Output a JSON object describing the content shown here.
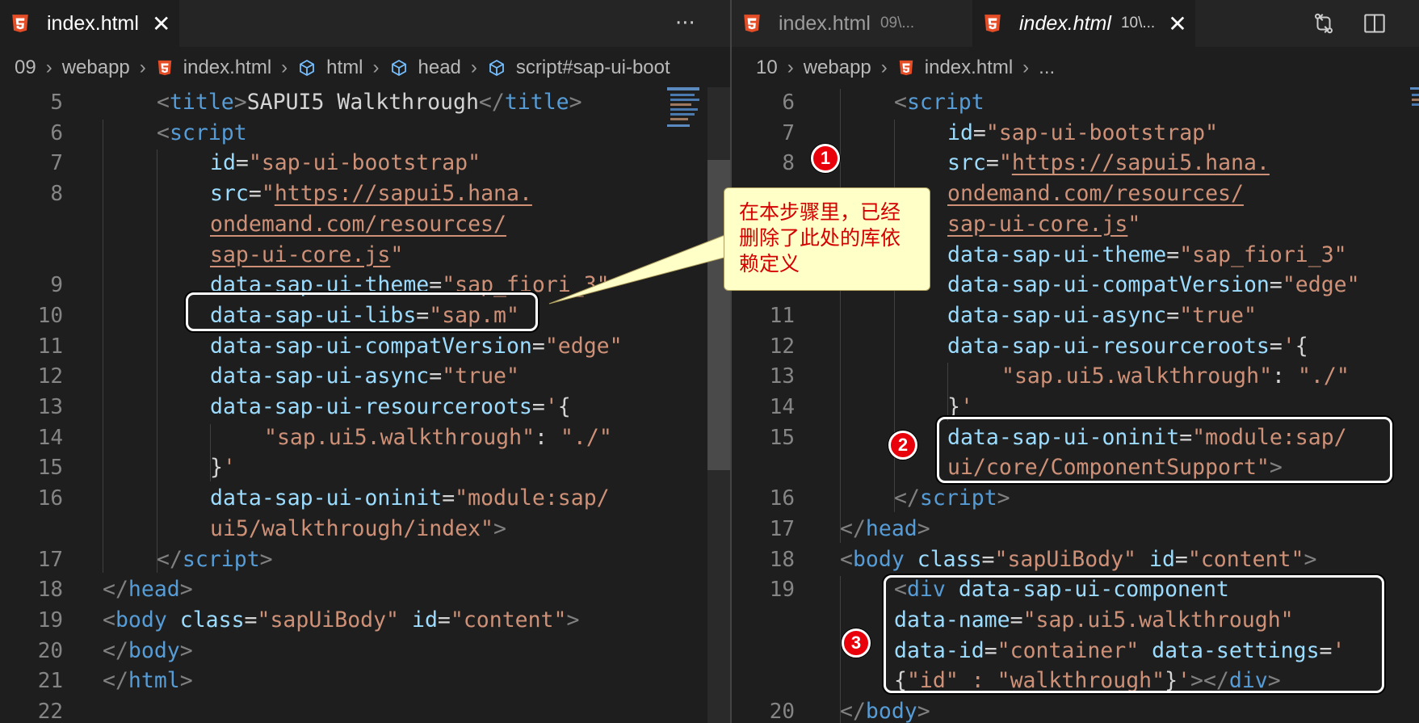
{
  "left": {
    "tabs": [
      {
        "title": "index.html"
      }
    ],
    "more_label": "···",
    "breadcrumb": [
      "09",
      "webapp",
      "index.html",
      "html",
      "head",
      "script#sap-ui-boot"
    ],
    "lines": [
      {
        "num": "5",
        "code": [
          [
            "p",
            "<"
          ],
          [
            "t",
            "title"
          ],
          [
            "p",
            ">"
          ],
          [
            "txt",
            "SAPUI5 Walkthrough"
          ],
          [
            "p",
            "</"
          ],
          [
            "t",
            "title"
          ],
          [
            "p",
            ">"
          ]
        ]
      },
      {
        "num": "6",
        "code": [
          [
            "p",
            "<"
          ],
          [
            "t",
            "script"
          ]
        ]
      },
      {
        "num": "7",
        "code": [
          [
            "a",
            "id"
          ],
          [
            "txt",
            "="
          ],
          [
            "s",
            "\"sap-ui-bootstrap\""
          ]
        ]
      },
      {
        "num": "8",
        "code": [
          [
            "a",
            "src"
          ],
          [
            "txt",
            "="
          ],
          [
            "s",
            "\""
          ],
          [
            "su",
            "https://sapui5.hana."
          ]
        ]
      },
      {
        "num": "",
        "code": [
          [
            "su",
            "ondemand.com/resources/"
          ]
        ]
      },
      {
        "num": "",
        "code": [
          [
            "su",
            "sap-ui-core.js"
          ],
          [
            "s",
            "\""
          ]
        ]
      },
      {
        "num": "9",
        "code": [
          [
            "a",
            "data-sap-ui-theme"
          ],
          [
            "txt",
            "="
          ],
          [
            "s",
            "\"sap_fiori_3\""
          ]
        ]
      },
      {
        "num": "10",
        "code": [
          [
            "a",
            "data-sap-ui-libs"
          ],
          [
            "txt",
            "="
          ],
          [
            "s",
            "\"sap.m\""
          ]
        ]
      },
      {
        "num": "11",
        "code": [
          [
            "a",
            "data-sap-ui-compatVersion"
          ],
          [
            "txt",
            "="
          ],
          [
            "s",
            "\"edge\""
          ]
        ]
      },
      {
        "num": "12",
        "code": [
          [
            "a",
            "data-sap-ui-async"
          ],
          [
            "txt",
            "="
          ],
          [
            "s",
            "\"true\""
          ]
        ]
      },
      {
        "num": "13",
        "code": [
          [
            "a",
            "data-sap-ui-resourceroots"
          ],
          [
            "txt",
            "="
          ],
          [
            "s",
            "'"
          ],
          [
            "txt",
            "{"
          ]
        ]
      },
      {
        "num": "14",
        "code": [
          [
            "s",
            "\"sap.ui5.walkthrough\""
          ],
          [
            "txt",
            ": "
          ],
          [
            "s",
            "\"./\""
          ]
        ]
      },
      {
        "num": "15",
        "code": [
          [
            "txt",
            "}"
          ],
          [
            "s",
            "'"
          ]
        ]
      },
      {
        "num": "16",
        "code": [
          [
            "a",
            "data-sap-ui-oninit"
          ],
          [
            "txt",
            "="
          ],
          [
            "s",
            "\"module:sap/"
          ]
        ]
      },
      {
        "num": "",
        "code": [
          [
            "s",
            "ui5/walkthrough/index\""
          ],
          [
            "p",
            ">"
          ]
        ]
      },
      {
        "num": "17",
        "code": [
          [
            "p",
            "</"
          ],
          [
            "t",
            "script"
          ],
          [
            "p",
            ">"
          ]
        ]
      },
      {
        "num": "18",
        "code": [
          [
            "p",
            "</"
          ],
          [
            "t",
            "head"
          ],
          [
            "p",
            ">"
          ]
        ]
      },
      {
        "num": "19",
        "code": [
          [
            "p",
            "<"
          ],
          [
            "t",
            "body"
          ],
          [
            "txt",
            " "
          ],
          [
            "a",
            "class"
          ],
          [
            "txt",
            "="
          ],
          [
            "s",
            "\"sapUiBody\""
          ],
          [
            "txt",
            " "
          ],
          [
            "a",
            "id"
          ],
          [
            "txt",
            "="
          ],
          [
            "s",
            "\"content\""
          ],
          [
            "p",
            ">"
          ]
        ]
      },
      {
        "num": "20",
        "code": [
          [
            "p",
            "</"
          ],
          [
            "t",
            "body"
          ],
          [
            "p",
            ">"
          ]
        ]
      },
      {
        "num": "21",
        "code": [
          [
            "p",
            "</"
          ],
          [
            "t",
            "html"
          ],
          [
            "p",
            ">"
          ]
        ]
      },
      {
        "num": "22",
        "code": []
      }
    ]
  },
  "right": {
    "tabs": [
      {
        "title": "index.html",
        "desc": "09\\..."
      },
      {
        "title": "index.html",
        "desc": "10\\...",
        "close": "✕"
      }
    ],
    "breadcrumb": [
      "10",
      "webapp",
      "index.html",
      "..."
    ],
    "lines": [
      {
        "num": "6",
        "code": [
          [
            "p",
            "<"
          ],
          [
            "t",
            "script"
          ]
        ]
      },
      {
        "num": "7",
        "code": [
          [
            "a",
            "id"
          ],
          [
            "txt",
            "="
          ],
          [
            "s",
            "\"sap-ui-bootstrap\""
          ]
        ]
      },
      {
        "num": "8",
        "code": [
          [
            "a",
            "src"
          ],
          [
            "txt",
            "="
          ],
          [
            "s",
            "\""
          ],
          [
            "su",
            "https://sapui5.hana."
          ]
        ]
      },
      {
        "num": "",
        "code": [
          [
            "su",
            "ondemand.com/resources/"
          ]
        ]
      },
      {
        "num": "",
        "code": [
          [
            "su",
            "sap-ui-core.js"
          ],
          [
            "s",
            "\""
          ]
        ]
      },
      {
        "num": "",
        "code": [
          [
            "a",
            "data-sap-ui-theme"
          ],
          [
            "txt",
            "="
          ],
          [
            "s",
            "\"sap_fiori_3\""
          ]
        ]
      },
      {
        "num": "",
        "code": [
          [
            "a",
            "data-sap-ui-compatVersion"
          ],
          [
            "txt",
            "="
          ],
          [
            "s",
            "\"edge\""
          ]
        ]
      },
      {
        "num": "11",
        "code": [
          [
            "a",
            "data-sap-ui-async"
          ],
          [
            "txt",
            "="
          ],
          [
            "s",
            "\"true\""
          ]
        ]
      },
      {
        "num": "12",
        "code": [
          [
            "a",
            "data-sap-ui-resourceroots"
          ],
          [
            "txt",
            "="
          ],
          [
            "s",
            "'"
          ],
          [
            "txt",
            "{"
          ]
        ]
      },
      {
        "num": "13",
        "code": [
          [
            "s",
            "\"sap.ui5.walkthrough\""
          ],
          [
            "txt",
            ": "
          ],
          [
            "s",
            "\"./\""
          ]
        ]
      },
      {
        "num": "14",
        "code": [
          [
            "txt",
            "}"
          ],
          [
            "s",
            "'"
          ]
        ]
      },
      {
        "num": "15",
        "code": [
          [
            "a",
            "data-sap-ui-oninit"
          ],
          [
            "txt",
            "="
          ],
          [
            "s",
            "\"module:sap/"
          ]
        ]
      },
      {
        "num": "",
        "code": [
          [
            "s",
            "ui/core/ComponentSupport\""
          ],
          [
            "p",
            ">"
          ]
        ]
      },
      {
        "num": "16",
        "code": [
          [
            "p",
            "</"
          ],
          [
            "t",
            "script"
          ],
          [
            "p",
            ">"
          ]
        ]
      },
      {
        "num": "17",
        "code": [
          [
            "p",
            "</"
          ],
          [
            "t",
            "head"
          ],
          [
            "p",
            ">"
          ]
        ]
      },
      {
        "num": "18",
        "code": [
          [
            "p",
            "<"
          ],
          [
            "t",
            "body"
          ],
          [
            "txt",
            " "
          ],
          [
            "a",
            "class"
          ],
          [
            "txt",
            "="
          ],
          [
            "s",
            "\"sapUiBody\""
          ],
          [
            "txt",
            " "
          ],
          [
            "a",
            "id"
          ],
          [
            "txt",
            "="
          ],
          [
            "s",
            "\"content\""
          ],
          [
            "p",
            ">"
          ]
        ]
      },
      {
        "num": "19",
        "code": [
          [
            "p",
            "<"
          ],
          [
            "t",
            "div"
          ],
          [
            "txt",
            " "
          ],
          [
            "a",
            "data-sap-ui-component"
          ]
        ]
      },
      {
        "num": "",
        "code": [
          [
            "a",
            "data-name"
          ],
          [
            "txt",
            "="
          ],
          [
            "s",
            "\"sap.ui5.walkthrough\""
          ]
        ]
      },
      {
        "num": "",
        "code": [
          [
            "a",
            "data-id"
          ],
          [
            "txt",
            "="
          ],
          [
            "s",
            "\"container\""
          ],
          [
            "txt",
            " "
          ],
          [
            "a",
            "data-settings"
          ],
          [
            "txt",
            "="
          ],
          [
            "s",
            "'"
          ]
        ]
      },
      {
        "num": "",
        "code": [
          [
            "txt",
            "{"
          ],
          [
            "s",
            "\"id\" : \"walkthrough\""
          ],
          [
            "txt",
            "}"
          ],
          [
            "s",
            "'"
          ],
          [
            "p",
            "></"
          ],
          [
            "t",
            "div"
          ],
          [
            "p",
            ">"
          ]
        ]
      },
      {
        "num": "20",
        "code": [
          [
            "p",
            "</"
          ],
          [
            "t",
            "body"
          ],
          [
            "p",
            ">"
          ]
        ]
      }
    ]
  },
  "annotations": {
    "callout_text": "在本步骤里，已经删除了此处的库依赖定义",
    "badges": [
      "1",
      "2",
      "3"
    ]
  },
  "colors": {
    "tag": "#569cd6",
    "punct": "#808080",
    "attr": "#9cdcfe",
    "string": "#ce9178",
    "badge": "#e8000b",
    "callout_bg": "#ffffc8",
    "callout_text": "#d40000"
  }
}
